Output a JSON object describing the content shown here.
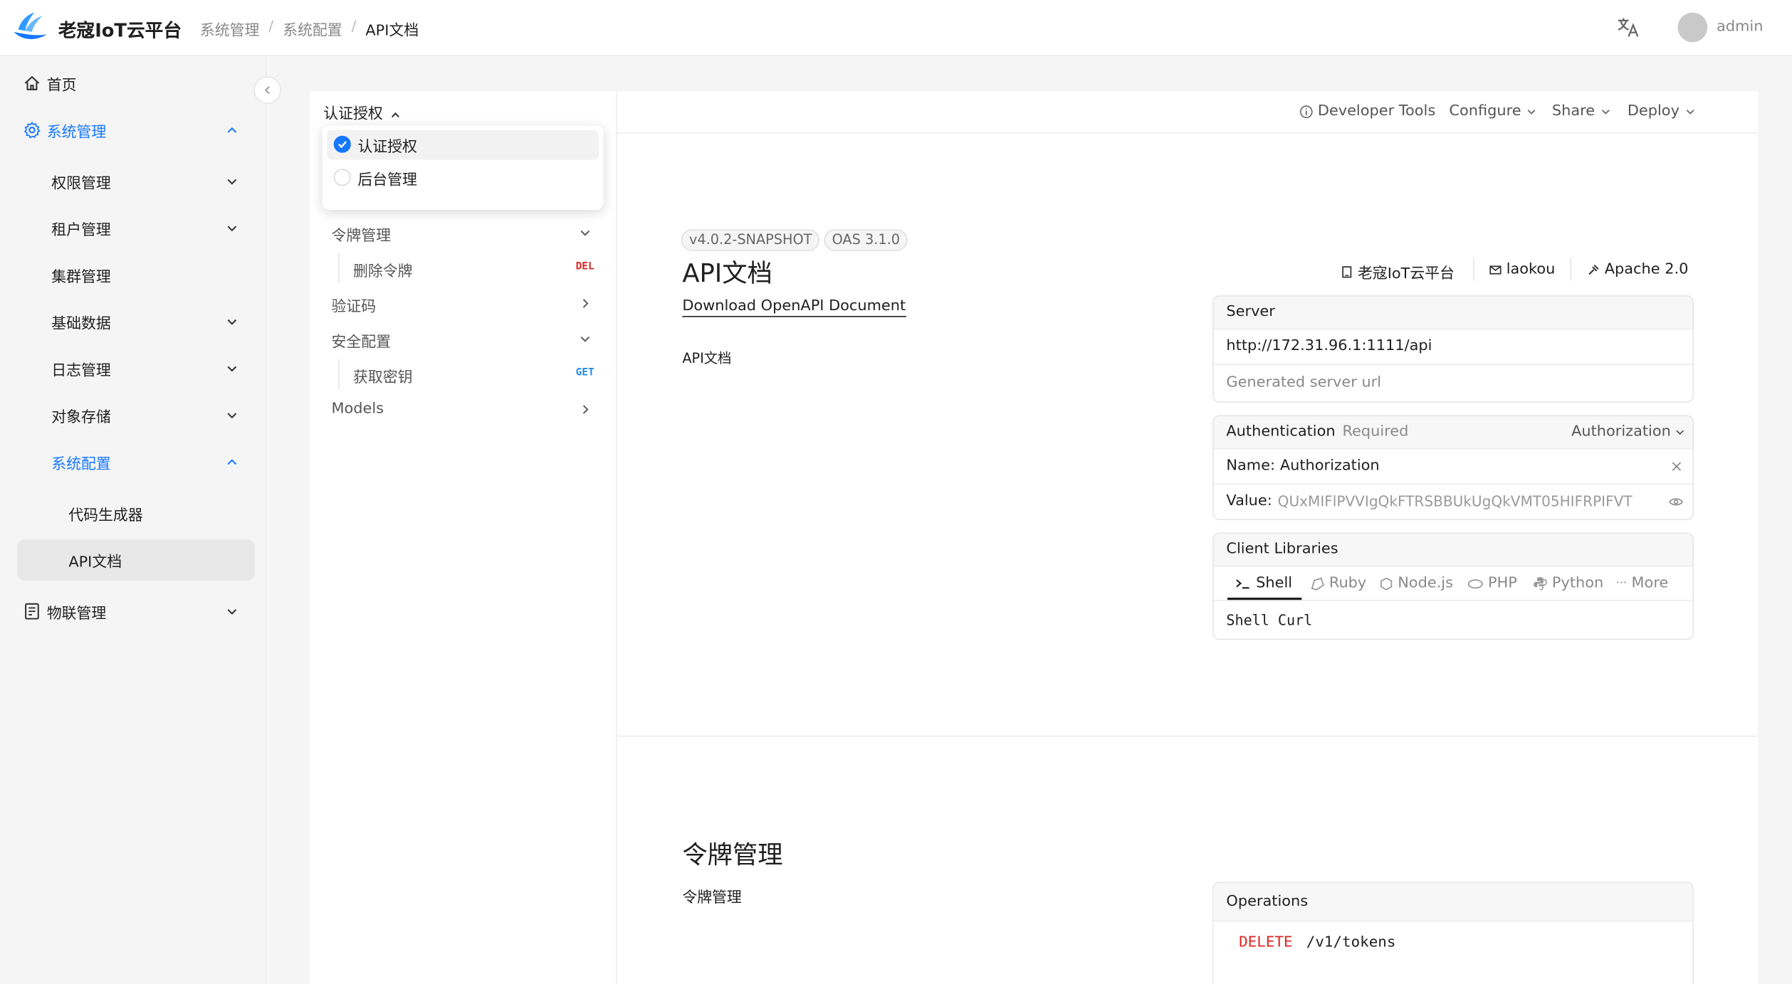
{
  "header": {
    "app_title": "老寇IoT云平台",
    "breadcrumb": [
      "系统管理",
      "系统配置",
      "API文档"
    ],
    "separator": "/",
    "user_name": "admin"
  },
  "sidebar": {
    "home": "首页",
    "system_management": "系统管理",
    "items": {
      "permissions": "权限管理",
      "tenants": "租户管理",
      "clusters": "集群管理",
      "base_data": "基础数据",
      "logs": "日志管理",
      "object_storage": "对象存储",
      "system_config": "系统配置",
      "code_generator": "代码生成器",
      "api_docs": "API文档"
    },
    "iot_management": "物联管理"
  },
  "doc_nav": {
    "selected_group": "认证授权",
    "dropdown": [
      "认证授权",
      "后台管理"
    ],
    "token_mgmt": "令牌管理",
    "delete_token": "删除令牌",
    "delete_method": "DEL",
    "captcha": "验证码",
    "security_config": "安全配置",
    "get_key": "获取密钥",
    "get_method": "GET",
    "models": "Models"
  },
  "toolbar": {
    "developer_tools": "Developer Tools",
    "configure": "Configure",
    "share": "Share",
    "deploy": "Deploy"
  },
  "info": {
    "version": "v4.0.2-SNAPSHOT",
    "oas": "OAS 3.1.0",
    "title": "API文档",
    "download": "Download OpenAPI Document",
    "description": "API文档",
    "platform_link": "老寇IoT云平台",
    "contact": "laokou",
    "license": "Apache 2.0"
  },
  "server": {
    "heading": "Server",
    "url": "http://172.31.96.1:1111/api",
    "description": "Generated server url"
  },
  "auth": {
    "heading": "Authentication",
    "required": "Required",
    "scheme": "Authorization",
    "name_label": "Name:",
    "name_value": "Authorization",
    "value_label": "Value:",
    "value_value": "QUxMIFlPVVIgQkFTRSBBUkUgQkVMT05HIFRPIFVT"
  },
  "client_libs": {
    "heading": "Client Libraries",
    "tabs": [
      "Shell",
      "Ruby",
      "Node.js",
      "PHP",
      "Python",
      "More"
    ],
    "selected_code": "Shell Curl"
  },
  "section2": {
    "title": "令牌管理",
    "description": "令牌管理",
    "operations_heading": "Operations",
    "method": "DELETE",
    "path": "/v1/tokens"
  },
  "colors": {
    "accent": "#1677ff",
    "delete": "#e02424",
    "get": "#1e88e5"
  }
}
